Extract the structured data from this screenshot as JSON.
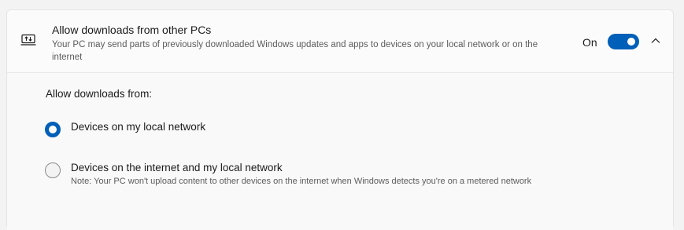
{
  "setting": {
    "icon": "laptop-share-icon",
    "title": "Allow downloads from other PCs",
    "description": "Your PC may send parts of previously downloaded Windows updates and apps to devices on your local network or on the internet",
    "toggle_state_label": "On",
    "toggle_on": true,
    "accent_color": "#005fb8",
    "expanded": true
  },
  "options": {
    "label": "Allow downloads from:",
    "items": [
      {
        "label": "Devices on my local network",
        "selected": true
      },
      {
        "label": "Devices on the internet and my local network",
        "note": "Note: Your PC won't upload content to other devices on the internet when Windows detects you're on a metered network",
        "selected": false
      }
    ]
  }
}
